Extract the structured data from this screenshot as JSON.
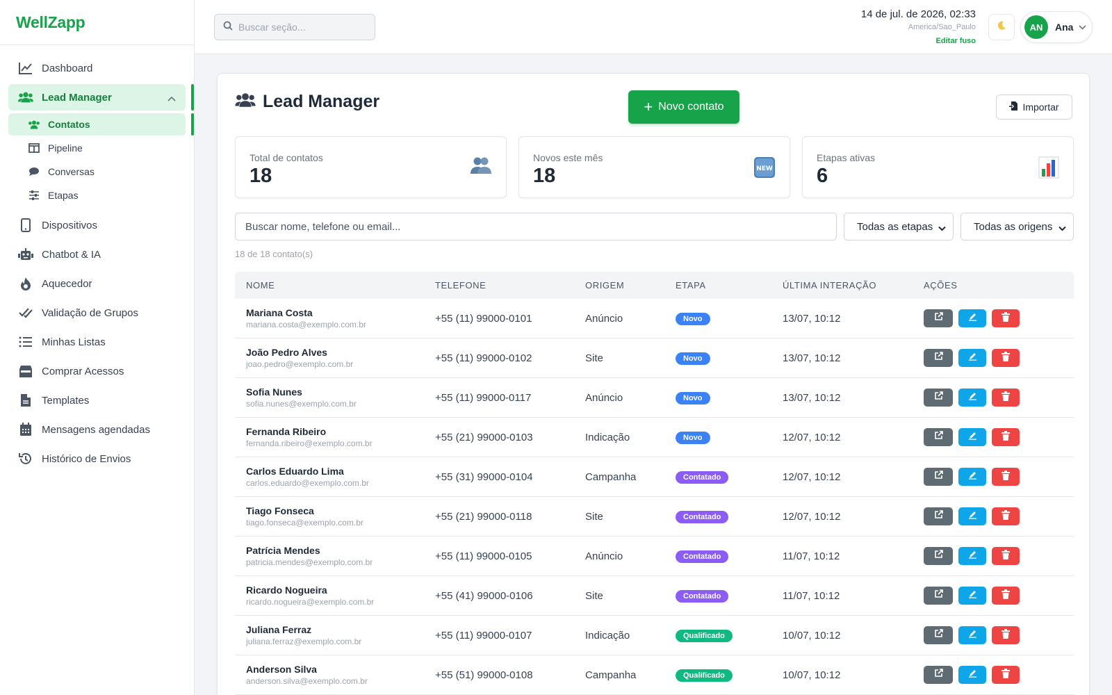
{
  "app": {
    "name": "WellZapp"
  },
  "sidebar": {
    "items_top": [
      {
        "label": "Dashboard",
        "icon": "chart-line-icon"
      }
    ],
    "lead_manager": {
      "label": "Lead Manager",
      "icon": "users-icon"
    },
    "subitems": [
      {
        "label": "Contatos",
        "icon": "users-icon",
        "active": true
      },
      {
        "label": "Pipeline",
        "icon": "columns-icon"
      },
      {
        "label": "Conversas",
        "icon": "comment-icon"
      },
      {
        "label": "Etapas",
        "icon": "sliders-icon"
      }
    ],
    "items_bottom": [
      {
        "label": "Dispositivos",
        "icon": "mobile-icon"
      },
      {
        "label": "Chatbot & IA",
        "icon": "robot-icon"
      },
      {
        "label": "Aquecedor",
        "icon": "fire-icon"
      },
      {
        "label": "Validação de Grupos",
        "icon": "check-double-icon"
      },
      {
        "label": "Minhas Listas",
        "icon": "list-icon"
      },
      {
        "label": "Comprar Acessos",
        "icon": "store-icon"
      },
      {
        "label": "Templates",
        "icon": "file-icon"
      },
      {
        "label": "Mensagens agendadas",
        "icon": "calendar-icon"
      },
      {
        "label": "Histórico de Envios",
        "icon": "history-icon"
      }
    ]
  },
  "header": {
    "search_placeholder": "Buscar seção...",
    "datetime": "14 de jul. de 2026, 02:33",
    "timezone": "America/Sao_Paulo",
    "edit_timezone": "Editar fuso",
    "user_initials": "AN",
    "user_name": "Ana"
  },
  "page": {
    "title": "Lead Manager",
    "new_contact": "Novo contato",
    "import": "Importar",
    "stats": [
      {
        "label": "Total de contatos",
        "value": "18",
        "icon": "users-emoji-icon"
      },
      {
        "label": "Novos este mês",
        "value": "18",
        "icon": "new-emoji-icon"
      },
      {
        "label": "Etapas ativas",
        "value": "6",
        "icon": "bar-chart-emoji-icon"
      }
    ],
    "filter_placeholder": "Buscar nome, telefone ou email...",
    "stage_filter": "Todas as etapas",
    "origin_filter": "Todas as origens",
    "count_text": "18 de 18 contato(s)"
  },
  "colors": {
    "accent": "#16a34a",
    "novo": "#3b82f6",
    "contatado": "#8b5cf6",
    "qualificado": "#10b981"
  },
  "table": {
    "headers": [
      "NOME",
      "TELEFONE",
      "ORIGEM",
      "ETAPA",
      "ÚLTIMA INTERAÇÃO",
      "AÇÕES"
    ],
    "rows": [
      {
        "name": "Mariana Costa",
        "email": "mariana.costa@exemplo.com.br",
        "phone": "+55 (11) 99000-0101",
        "origin": "Anúncio",
        "stage": "Novo",
        "last": "13/07, 10:12"
      },
      {
        "name": "João Pedro Alves",
        "email": "joao.pedro@exemplo.com.br",
        "phone": "+55 (11) 99000-0102",
        "origin": "Site",
        "stage": "Novo",
        "last": "13/07, 10:12"
      },
      {
        "name": "Sofia Nunes",
        "email": "sofia.nunes@exemplo.com.br",
        "phone": "+55 (11) 99000-0117",
        "origin": "Anúncio",
        "stage": "Novo",
        "last": "13/07, 10:12"
      },
      {
        "name": "Fernanda Ribeiro",
        "email": "fernanda.ribeiro@exemplo.com.br",
        "phone": "+55 (21) 99000-0103",
        "origin": "Indicação",
        "stage": "Novo",
        "last": "12/07, 10:12"
      },
      {
        "name": "Carlos Eduardo Lima",
        "email": "carlos.eduardo@exemplo.com.br",
        "phone": "+55 (31) 99000-0104",
        "origin": "Campanha",
        "stage": "Contatado",
        "last": "12/07, 10:12"
      },
      {
        "name": "Tiago Fonseca",
        "email": "tiago.fonseca@exemplo.com.br",
        "phone": "+55 (21) 99000-0118",
        "origin": "Site",
        "stage": "Contatado",
        "last": "12/07, 10:12"
      },
      {
        "name": "Patrícia Mendes",
        "email": "patricia.mendes@exemplo.com.br",
        "phone": "+55 (11) 99000-0105",
        "origin": "Anúncio",
        "stage": "Contatado",
        "last": "11/07, 10:12"
      },
      {
        "name": "Ricardo Nogueira",
        "email": "ricardo.nogueira@exemplo.com.br",
        "phone": "+55 (41) 99000-0106",
        "origin": "Site",
        "stage": "Contatado",
        "last": "11/07, 10:12"
      },
      {
        "name": "Juliana Ferraz",
        "email": "juliana.ferraz@exemplo.com.br",
        "phone": "+55 (11) 99000-0107",
        "origin": "Indicação",
        "stage": "Qualificado",
        "last": "10/07, 10:12"
      },
      {
        "name": "Anderson Silva",
        "email": "anderson.silva@exemplo.com.br",
        "phone": "+55 (51) 99000-0108",
        "origin": "Campanha",
        "stage": "Qualificado",
        "last": "10/07, 10:12"
      }
    ]
  }
}
